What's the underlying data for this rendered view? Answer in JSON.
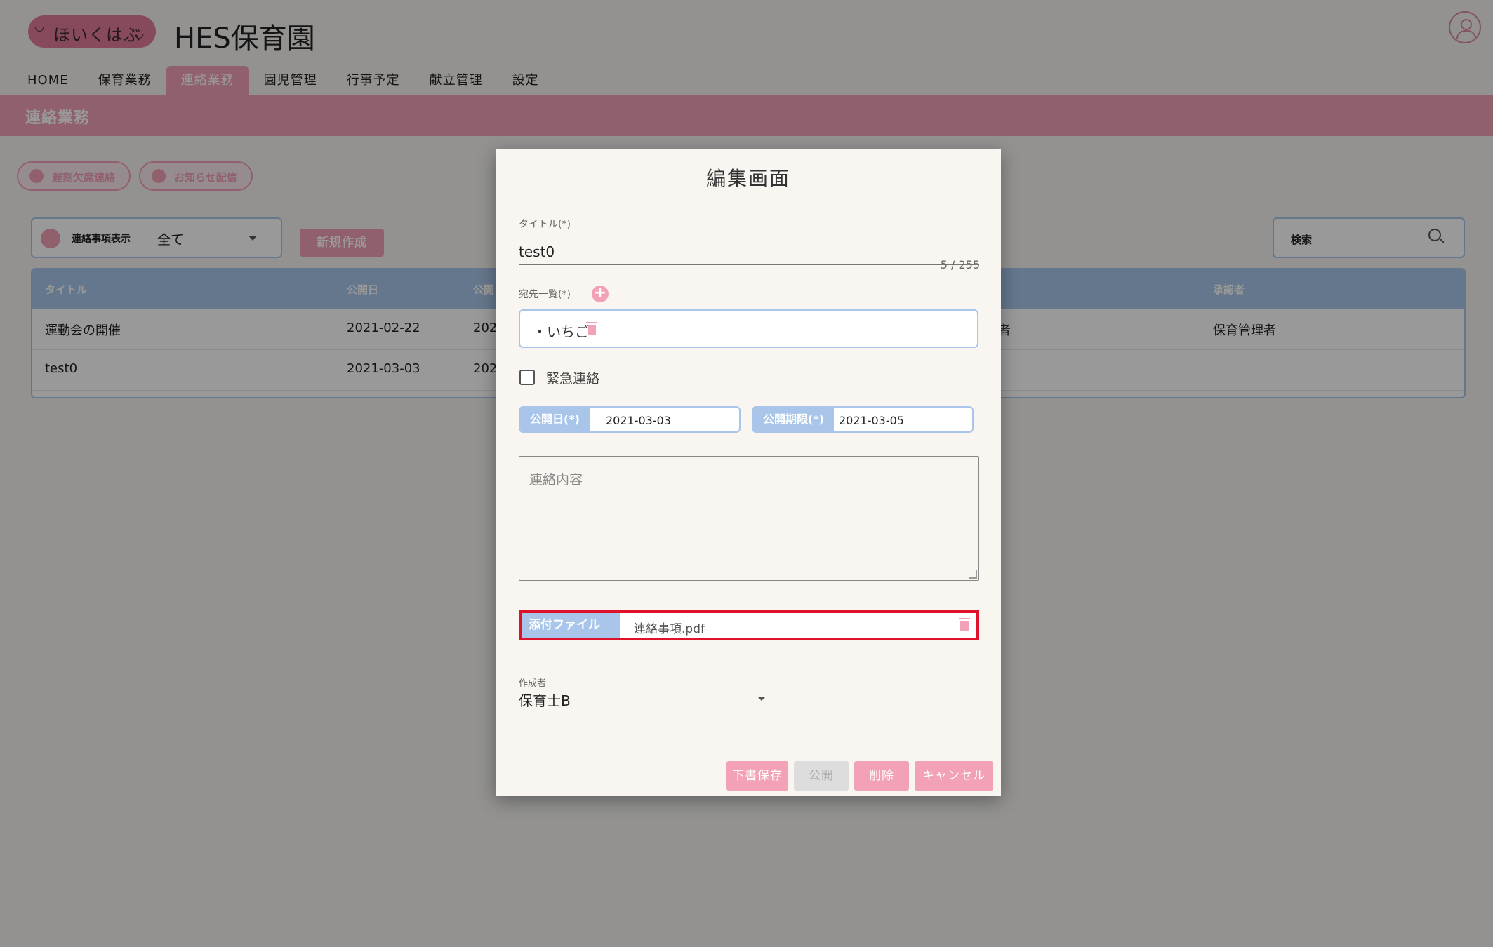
{
  "logo": {
    "text": "ほいくはぶ"
  },
  "site_title": "HES保育園",
  "nav": {
    "items": [
      {
        "label": "HOME"
      },
      {
        "label": "保育業務"
      },
      {
        "label": "連絡業務"
      },
      {
        "label": "園児管理"
      },
      {
        "label": "行事予定"
      },
      {
        "label": "献立管理"
      },
      {
        "label": "設定"
      }
    ],
    "active": "連絡業務"
  },
  "band_title": "連絡業務",
  "pills": [
    {
      "label": "遅刻欠席連絡"
    },
    {
      "label": "お知らせ配信"
    }
  ],
  "filter": {
    "label": "連絡事項表示",
    "value": "全て"
  },
  "new_button": "新規作成",
  "search": {
    "label": "検索"
  },
  "table": {
    "headers": [
      "タイトル",
      "公開日",
      "公開",
      "承認者"
    ],
    "rows": [
      {
        "title": "運動会の開催",
        "date": "2021-02-22",
        "date2": "202",
        "extra": "者",
        "approver": "保育管理者"
      },
      {
        "title": "test0",
        "date": "2021-03-03",
        "date2": "202",
        "extra": "",
        "approver": ""
      }
    ]
  },
  "modal": {
    "title": "編集画面",
    "title_label": "タイトル(*)",
    "title_value": "test0",
    "counter": "5 / 255",
    "dest_label": "宛先一覧(*)",
    "dest_items": [
      "・いちご"
    ],
    "urgent_label": "緊急連絡",
    "publish_date_label": "公開日(*)",
    "publish_date": "2021-03-03",
    "expire_label": "公開期限(*)",
    "expire_date": "2021-03-05",
    "content_placeholder": "連絡内容",
    "attach_label": "添付ファイル",
    "attach_file": "連絡事項.pdf",
    "author_label": "作成者",
    "author_value": "保育士B",
    "buttons": {
      "draft": "下書保存",
      "publish": "公開",
      "delete": "削除",
      "cancel": "キャンセル"
    }
  },
  "colors": {
    "accent_pink": "#f2a1b6",
    "accent_blue": "#a9c6ea",
    "highlight_red": "#e0112b"
  }
}
